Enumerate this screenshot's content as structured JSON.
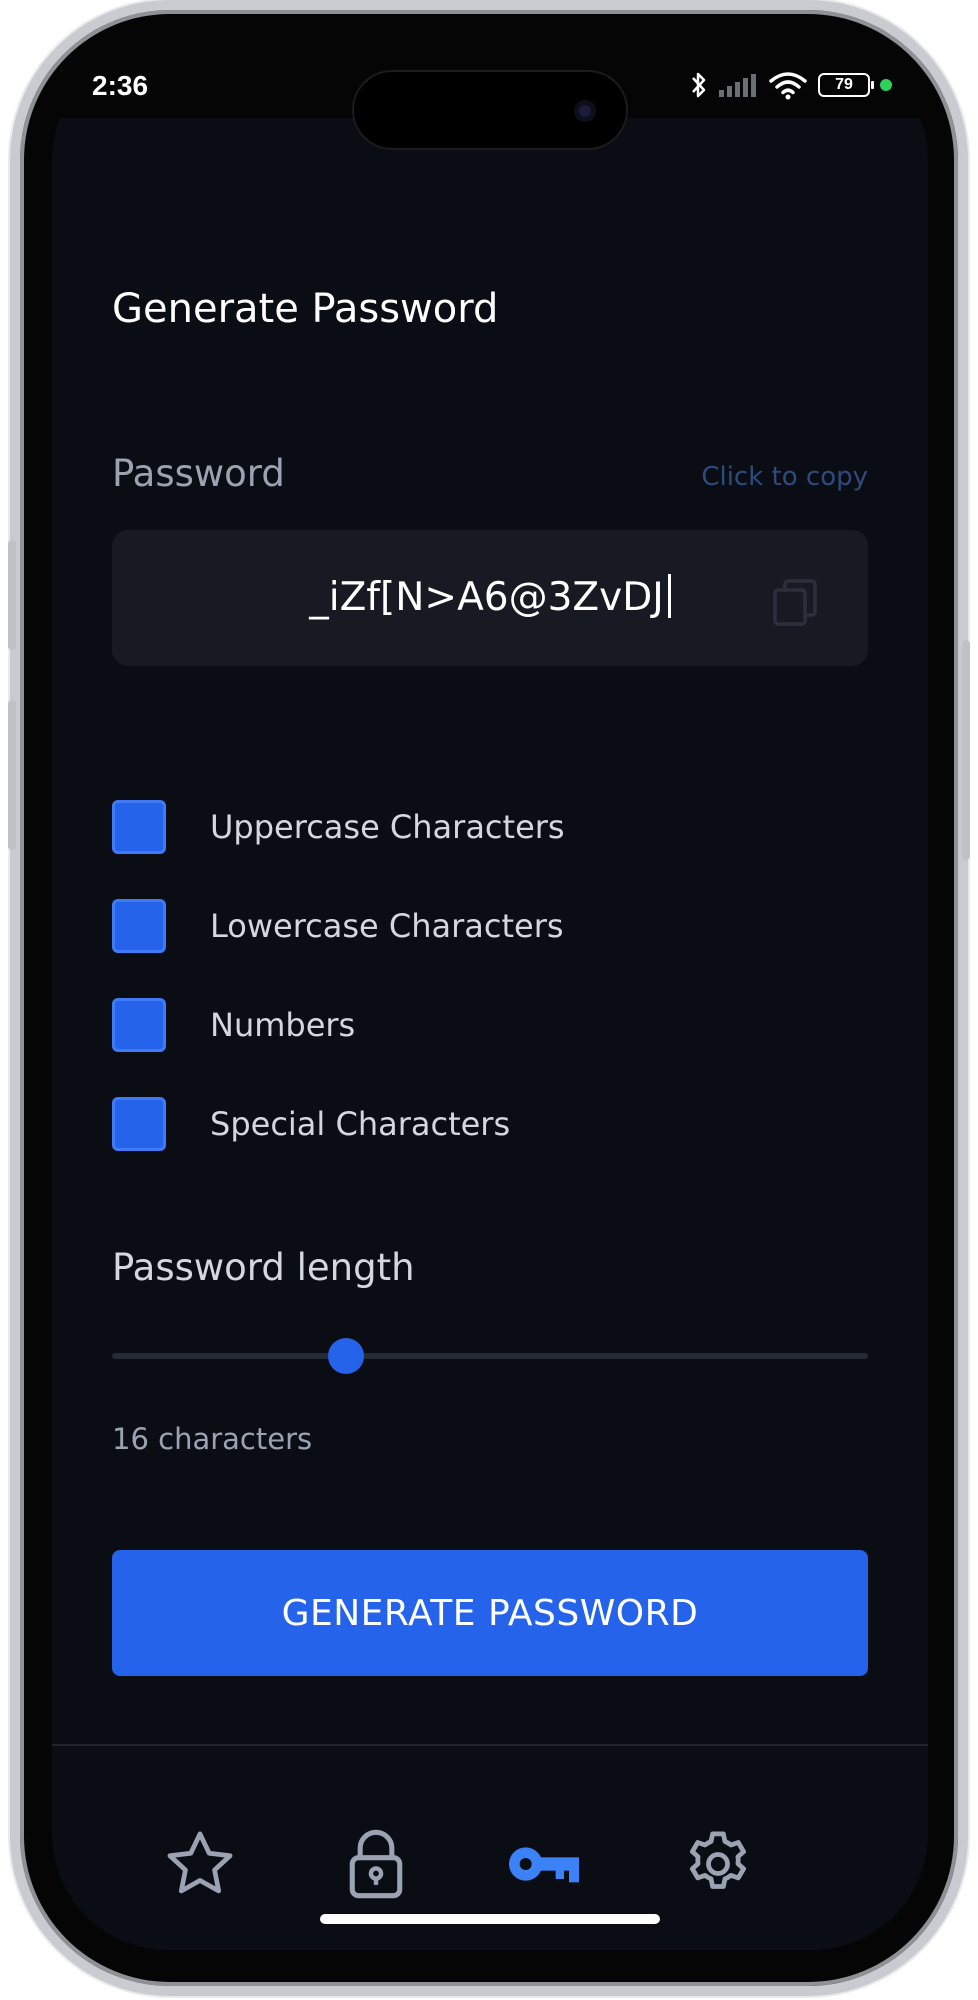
{
  "status_bar": {
    "time": "2:36",
    "battery": "79"
  },
  "page": {
    "title": "Generate Password"
  },
  "password": {
    "label": "Password",
    "copy_hint": "Click to copy",
    "value": "_iZf[N>A6@3ZvDJ"
  },
  "options": [
    {
      "label": "Uppercase Characters",
      "checked": true
    },
    {
      "label": "Lowercase Characters",
      "checked": true
    },
    {
      "label": "Numbers",
      "checked": true
    },
    {
      "label": "Special Characters",
      "checked": true
    }
  ],
  "length": {
    "label": "Password length",
    "value_text": "16 characters",
    "slider_fraction": 0.31
  },
  "generate_button": {
    "label": "GENERATE PASSWORD"
  },
  "tab_bar": {
    "tabs": [
      {
        "icon": "star-icon",
        "active": false
      },
      {
        "icon": "lock-icon",
        "active": false
      },
      {
        "icon": "key-icon",
        "active": true
      },
      {
        "icon": "gear-icon",
        "active": false
      }
    ]
  },
  "colors": {
    "background": "#0b0d14",
    "accent": "#2563eb",
    "field_background": "#171a23",
    "muted_text": "#9ba3b2",
    "inactive_icon": "#9ba3b2"
  }
}
